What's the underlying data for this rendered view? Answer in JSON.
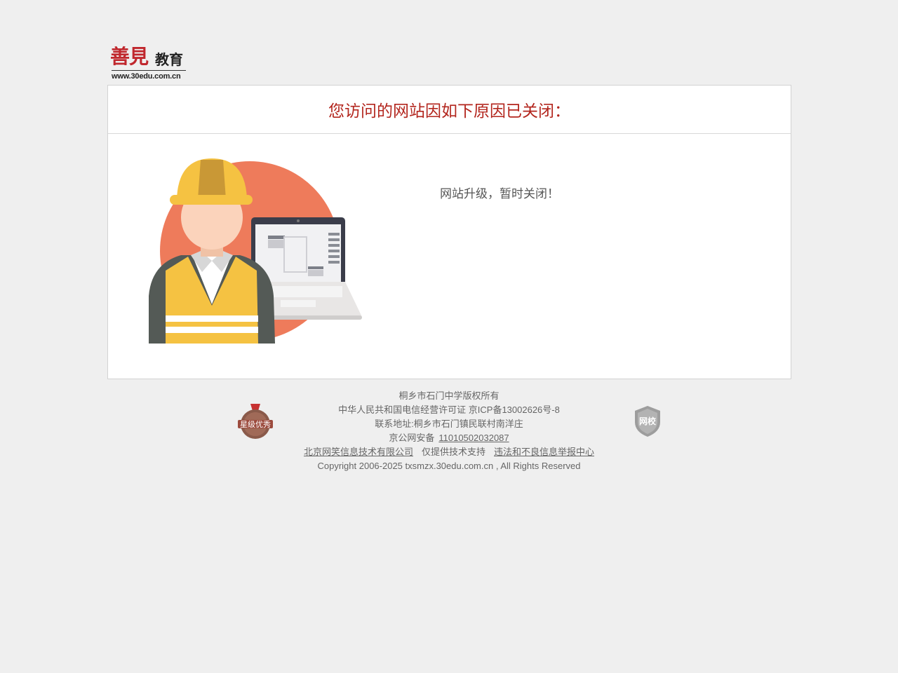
{
  "logo": {
    "main": "善見",
    "sub": "教育",
    "url": "www.30edu.com.cn"
  },
  "card": {
    "title": "您访问的网站因如下原因已关闭：",
    "reason": "网站升级，暂时关闭！"
  },
  "footer": {
    "copyright_owner": "桐乡市石门中学版权所有",
    "license": "中华人民共和国电信经营许可证 京ICP备13002626号-8",
    "address": "联系地址:桐乡市石门镇民联村南洋庄",
    "police_prefix": "京公网安备",
    "police_number": "11010502032087",
    "company_link": "北京网笑信息技术有限公司",
    "support_text": "仅提供技术支持",
    "report_link": "违法和不良信息举报中心",
    "copyright": "Copyright 2006-2025 txsmzx.30edu.com.cn , All Rights Reserved"
  },
  "badges": {
    "left_label": "星级优秀",
    "right_label": "网校"
  },
  "colors": {
    "accent_red": "#b3261e",
    "background": "#efefef",
    "illustration_circle": "#ee7b5b",
    "helmet": "#f5c242"
  }
}
